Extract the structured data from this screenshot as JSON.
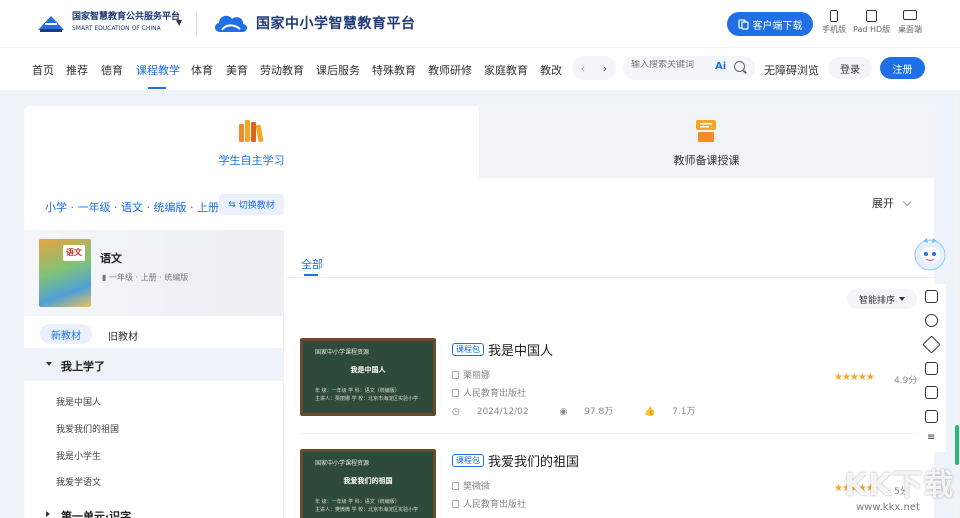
{
  "header": {
    "org_name_cn": "国家智慧教育公共服务平台",
    "org_name_en": "SMART EDUCATION OF CHINA",
    "platform_name": "国家中小学智慧教育平台",
    "download_label": "客户端下载",
    "devices": [
      {
        "label": "手机版",
        "icon": "phone-icon"
      },
      {
        "label": "Pad HD版",
        "icon": "tablet-icon"
      },
      {
        "label": "桌面端",
        "icon": "desktop-icon"
      }
    ]
  },
  "nav": {
    "items": [
      "首页",
      "推荐",
      "德育",
      "课程教学",
      "体育",
      "美育",
      "劳动教育",
      "课后服务",
      "特殊教育",
      "教师研修",
      "家庭教育",
      "教改"
    ],
    "active": "课程教学",
    "search_placeholder": "输入搜索关键词",
    "ai_label": "Ai",
    "accessibility": "无障碍浏览",
    "login": "登录",
    "register": "注册"
  },
  "modes": [
    {
      "label": "学生自主学习",
      "icon": "books-icon",
      "active": true
    },
    {
      "label": "教师备课授课",
      "icon": "lectern-icon",
      "active": false
    }
  ],
  "filter": {
    "breadcrumb": "小学 · 一年级 · 语文 · 统编版 · 上册",
    "switch_label": "切换教材",
    "expand_label": "展开"
  },
  "book": {
    "title": "语文",
    "cover_text": "语文",
    "meta": "一年级 · 上册 · 统编版"
  },
  "version_tabs": {
    "new": "新教材",
    "old": "旧教材"
  },
  "units": [
    {
      "label": "我上学了",
      "expanded": true,
      "lessons": [
        "我是中国人",
        "我爱我们的祖国",
        "我是小学生",
        "我爱学语文"
      ]
    },
    {
      "label": "第一单元·识字",
      "expanded": false,
      "lessons": []
    }
  ],
  "content": {
    "tab_all": "全部",
    "sort_label": "智能排序",
    "courses": [
      {
        "tag": "课程包",
        "title": "我是中国人",
        "author": "栗丽娜",
        "publisher": "人民教育出版社",
        "date": "2024/12/02",
        "views": "97.8万",
        "likes": "7.1万",
        "rating": 4.9,
        "score_label": "4.9分",
        "thumb_header": "国家中小学课程资源",
        "thumb_title": "我是中国人",
        "thumb_row1": "年    级：一年级          学    科：语文（统编版）",
        "thumb_row2": "主讲人：栗丽娜          学    校：北京市海淀区实验小学"
      },
      {
        "tag": "课程包",
        "title": "我爱我们的祖国",
        "author": "樊微微",
        "publisher": "人民教育出版社",
        "date": "",
        "views": "",
        "likes": "",
        "rating": 5.0,
        "score_label": "5分",
        "thumb_header": "国家中小学课程资源",
        "thumb_title": "我爱我们的祖国",
        "thumb_row1": "年    级：一年级          学    科：语文（统编版）",
        "thumb_row2": "主讲人：樊微微          学    校：北京市海淀区实验小学"
      }
    ]
  },
  "watermark": {
    "big": "KK下载",
    "url": "www.kkx.net"
  },
  "colors": {
    "accent": "#1f6fe6",
    "star": "#f5a623"
  }
}
